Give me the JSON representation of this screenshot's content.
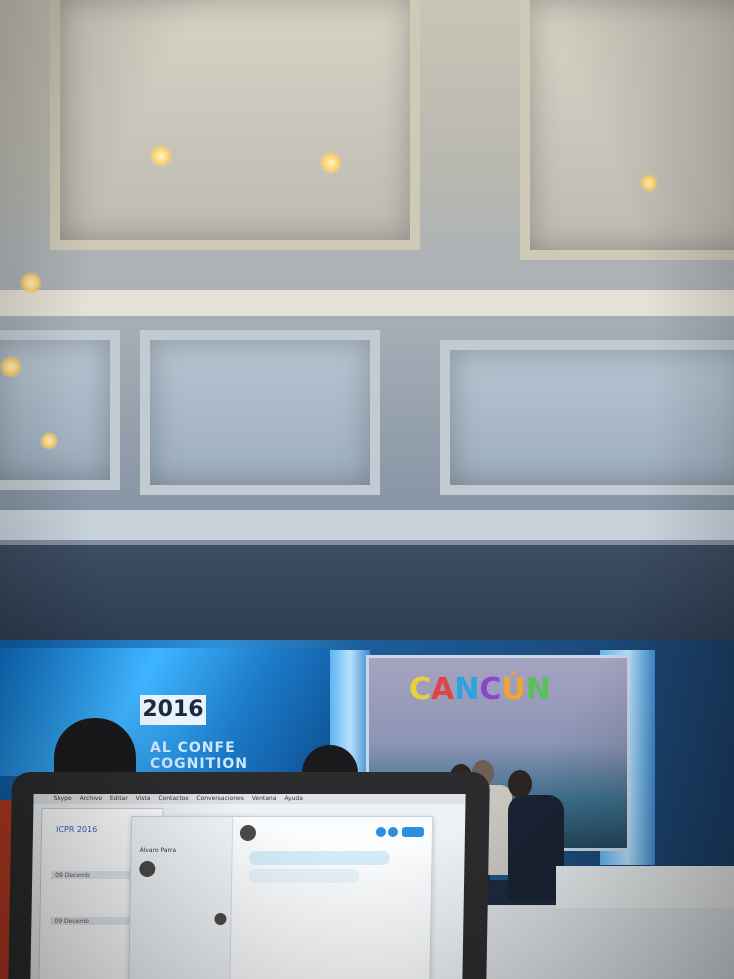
{
  "scene": {
    "description_tags": [
      "conference-hall",
      "stage",
      "projection-screen",
      "laptop"
    ],
    "accent_colors": {
      "stage_blue": "#2f8fd6",
      "ceiling": "#c9c4b6",
      "laptop": "#2c2c2e"
    }
  },
  "banner": {
    "year": "2016",
    "line1": "AL CONFE",
    "line2": "COGNITION"
  },
  "screen": {
    "letters": [
      "C",
      "A",
      "N",
      "C",
      "Ú",
      "N"
    ]
  },
  "laptop": {
    "menubar": [
      "Skype",
      "Archivo",
      "Editar",
      "Vista",
      "Contactos",
      "Conversaciones",
      "Ventana",
      "Ayuda"
    ],
    "doc": {
      "title": "ICPR 2016",
      "rows": [
        "09 Decemb",
        "09 Decemb"
      ]
    },
    "chat": {
      "contact_top": "Álvaro Parra"
    }
  }
}
